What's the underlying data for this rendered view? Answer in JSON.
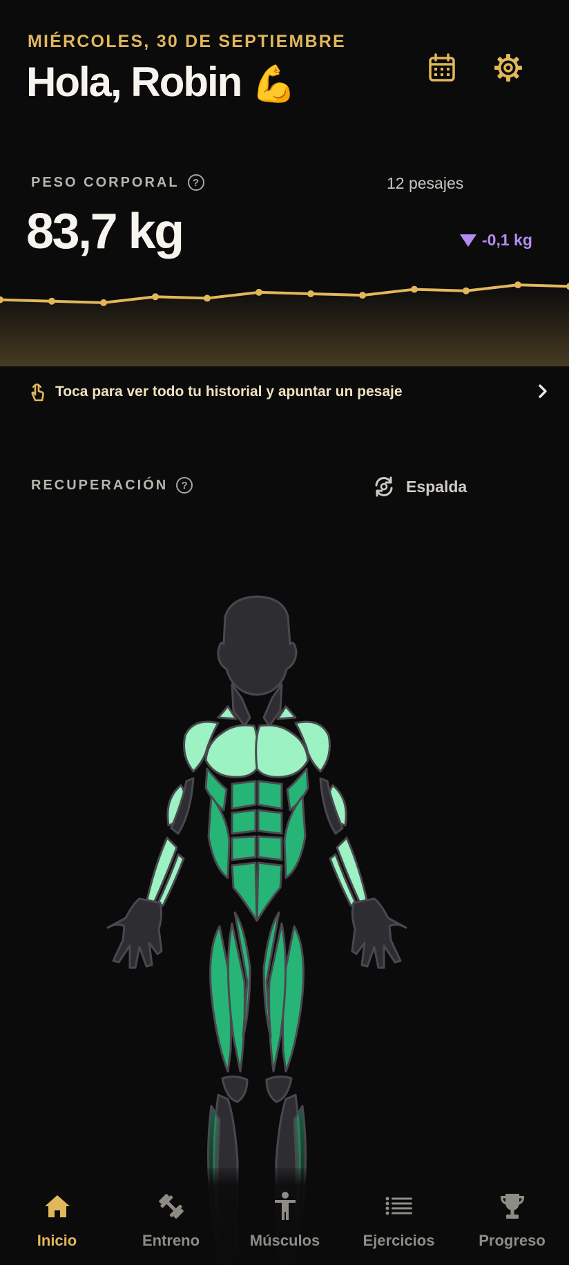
{
  "header": {
    "date": "MIÉRCOLES, 30 DE SEPTIEMBRE",
    "greeting": "Hola, Robin",
    "greeting_emoji": "💪",
    "icons": [
      "calendar-icon",
      "gear-icon"
    ],
    "accent_color": "#e2b75a"
  },
  "weight": {
    "label": "PESO CORPORAL",
    "help_glyph": "?",
    "count": "12 pesajes",
    "value": "83,7 kg",
    "delta": "-0,1 kg",
    "delta_color": "#b58cf0",
    "trend_values": [
      83.5,
      83.45,
      83.4,
      83.6,
      83.55,
      83.75,
      83.7,
      83.65,
      83.85,
      83.8,
      84.0,
      83.95
    ],
    "history_text": "Toca para ver todo tu historial y apuntar un pesaje",
    "history_icon": "tap-hand-icon"
  },
  "recovery": {
    "label": "RECUPERACIÓN",
    "help_glyph": "?",
    "view_toggle": "Espalda",
    "view_icon": "rotate-icon",
    "colors": {
      "recovered": "#9cf2c3",
      "mid": "#27b577",
      "inactive": "#2e2d31"
    }
  },
  "tabs": [
    {
      "label": "Inicio",
      "icon": "home-icon",
      "active": true
    },
    {
      "label": "Entreno",
      "icon": "dumbbell-icon",
      "active": false
    },
    {
      "label": "Músculos",
      "icon": "body-icon",
      "active": false
    },
    {
      "label": "Ejercicios",
      "icon": "list-icon",
      "active": false
    },
    {
      "label": "Progreso",
      "icon": "trophy-icon",
      "active": false
    }
  ]
}
